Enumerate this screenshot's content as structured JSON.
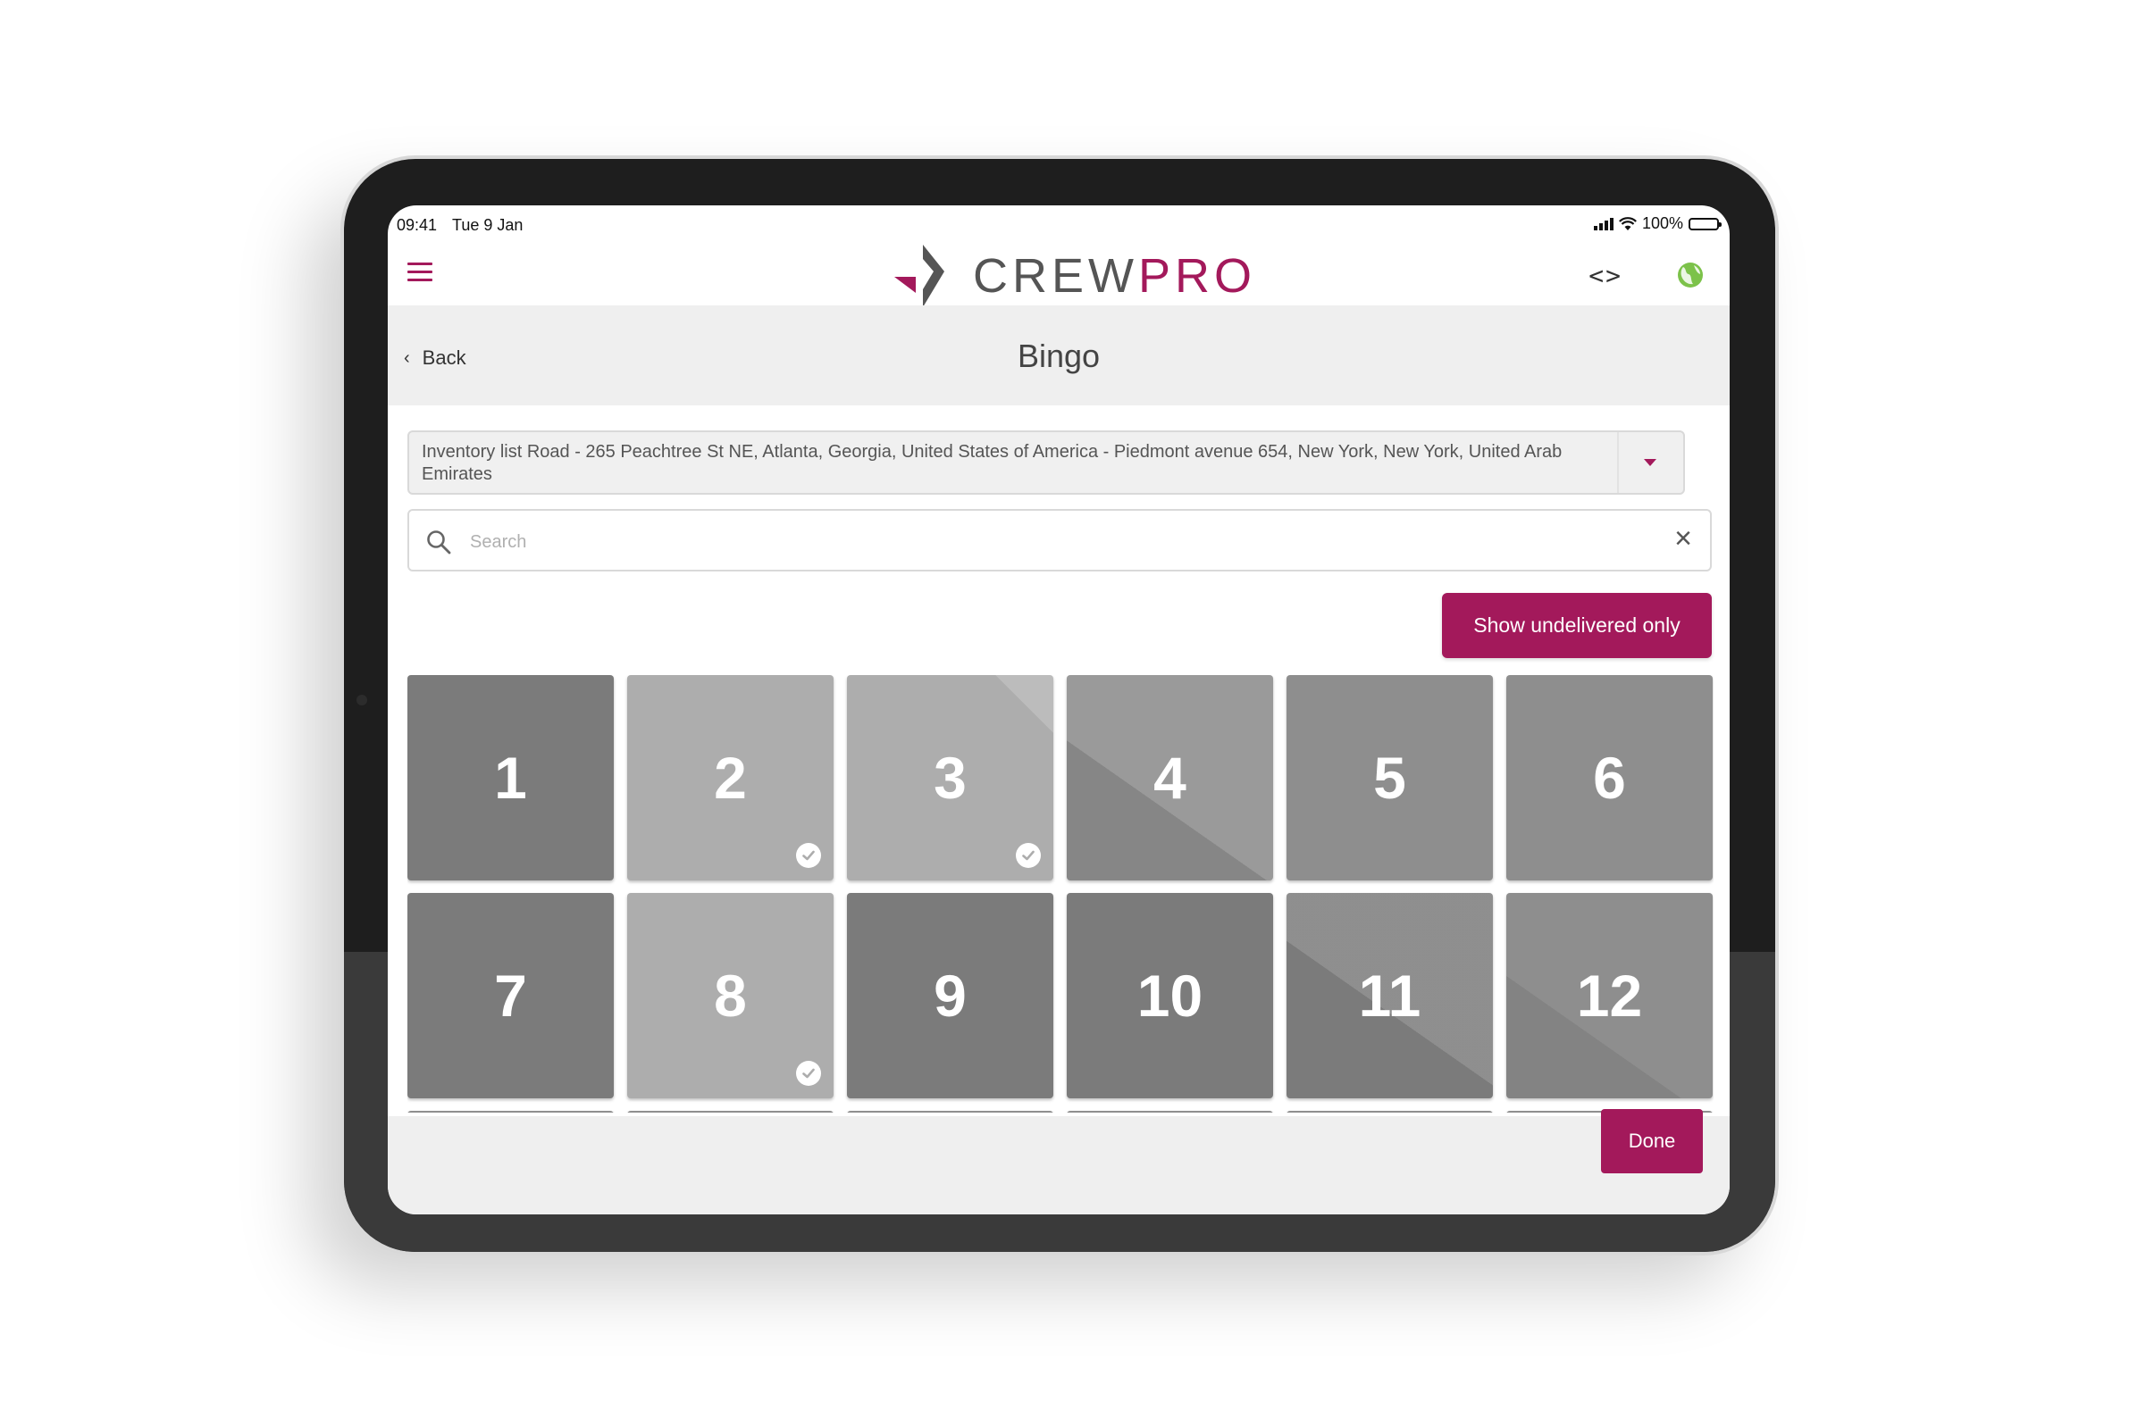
{
  "status_bar": {
    "time": "09:41",
    "date": "Tue 9 Jan",
    "battery": "100%"
  },
  "header": {
    "logo_crew": "CREW",
    "logo_pro": "PRO",
    "accent_color": "#a3195b",
    "icons": [
      "hamburger-menu-icon",
      "code-brackets-icon",
      "globe-icon"
    ]
  },
  "nav": {
    "back_label": "Back",
    "title": "Bingo"
  },
  "inventory_select": {
    "value": "Inventory list Road - 265 Peachtree St NE, Atlanta, Georgia, United States of America - Piedmont avenue 654, New York, New York, United Arab Emirates"
  },
  "search": {
    "placeholder": "Search",
    "value": ""
  },
  "filter_button": {
    "label": "Show undelivered only"
  },
  "tiles": [
    {
      "label": "1",
      "delivered": false,
      "color": "#7b7b7b"
    },
    {
      "label": "2",
      "delivered": true,
      "color": "#adadad"
    },
    {
      "label": "3",
      "delivered": true,
      "color": "#adadad"
    },
    {
      "label": "4",
      "delivered": false,
      "color": "#8e8e8e"
    },
    {
      "label": "5",
      "delivered": false,
      "color": "#8e8e8e"
    },
    {
      "label": "6",
      "delivered": false,
      "color": "#8e8e8e"
    },
    {
      "label": "7",
      "delivered": false,
      "color": "#7b7b7b"
    },
    {
      "label": "8",
      "delivered": true,
      "color": "#adadad"
    },
    {
      "label": "9",
      "delivered": false,
      "color": "#7b7b7b"
    },
    {
      "label": "10",
      "delivered": false,
      "color": "#7b7b7b"
    },
    {
      "label": "11",
      "delivered": false,
      "color": "#7b7b7b"
    },
    {
      "label": "12",
      "delivered": false,
      "color": "#8e8e8e"
    }
  ],
  "footer": {
    "done_label": "Done"
  }
}
